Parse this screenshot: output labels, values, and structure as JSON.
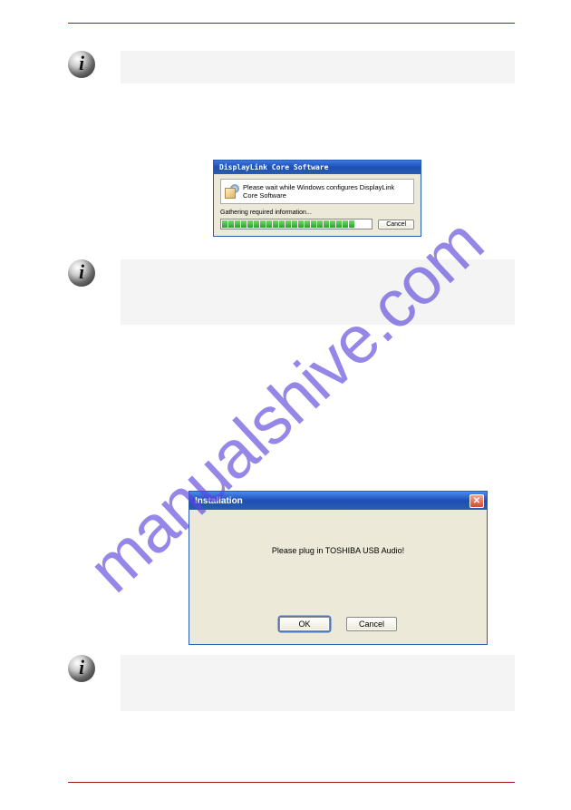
{
  "watermark": "manualshive.com",
  "dialog1": {
    "title": "DisplayLink Core Software",
    "message": "Please wait while Windows configures DisplayLink Core Software",
    "status": "Gathering required information...",
    "cancel": "Cancel"
  },
  "dialog2": {
    "title": "Installation",
    "message": "Please plug in TOSHIBA USB Audio!",
    "ok": "OK",
    "cancel": "Cancel"
  }
}
